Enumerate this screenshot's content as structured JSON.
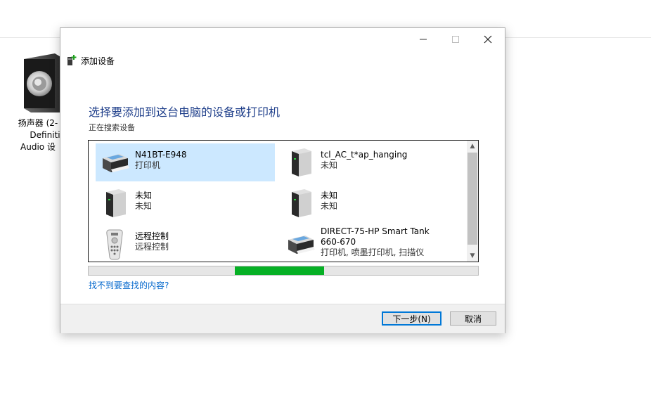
{
  "desktop": {
    "icon": "speaker-icon",
    "label_line1": "扬声器 (2-",
    "label_line2": "Definiti",
    "label_line3": "Audio 设"
  },
  "dialog": {
    "title": "添加设备",
    "title_icon": "add-device-icon",
    "heading": "选择要添加到这台电脑的设备或打印机",
    "status": "正在搜索设备",
    "devices": [
      {
        "name": "N41BT-E948",
        "type": "打印机",
        "icon": "printer-icon",
        "selected": true
      },
      {
        "name": "tcl_AC_t*ap_hanging",
        "type": "未知",
        "icon": "computer-tower-icon",
        "selected": false
      },
      {
        "name": "未知",
        "type": "未知",
        "icon": "computer-tower-icon",
        "selected": false
      },
      {
        "name": "未知",
        "type": "未知",
        "icon": "computer-tower-icon",
        "selected": false
      },
      {
        "name": "远程控制",
        "type": "远程控制",
        "icon": "remote-control-icon",
        "selected": false
      },
      {
        "name": "DIRECT-75-HP Smart Tank",
        "name_line2": "660-670",
        "type": "打印机, 喷墨打印机, 扫描仪",
        "icon": "printer-icon",
        "selected": false
      }
    ],
    "progress_start_fraction": 0.376,
    "progress_end_fraction": 0.605,
    "help_link": "找不到要查找的内容?",
    "next_label": "下一步(N)",
    "cancel_label": "取消"
  },
  "colors": {
    "heading": "#1e3e8a",
    "link": "#0066cc",
    "selection": "#cce8ff",
    "progress": "#06b025",
    "accent_border": "#0078d7"
  }
}
